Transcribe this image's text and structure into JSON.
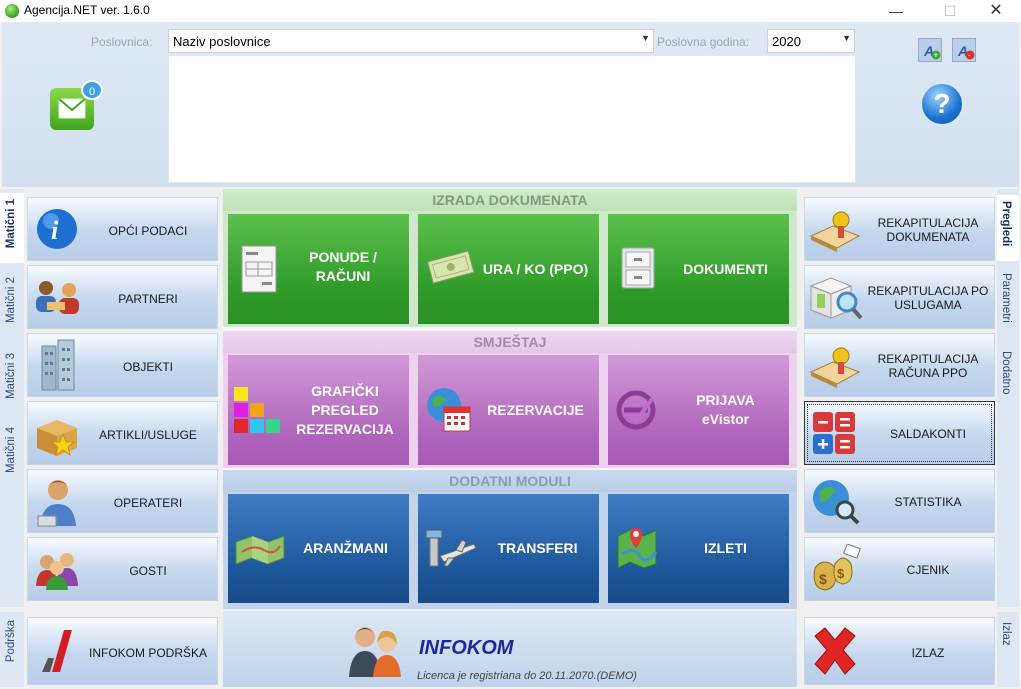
{
  "window": {
    "title": "Agencija.NET ver. 1.6.0"
  },
  "header": {
    "branch_label": "Poslovnica:",
    "branch_value": "Naziv poslovnice",
    "year_label": "Poslovna godina:",
    "year_value": "2020",
    "mail_count": "0"
  },
  "left_tabs": [
    "Matični 1",
    "Matični 2",
    "Matični 3",
    "Matični 4"
  ],
  "left_bottom_tab": "Podrška",
  "right_tabs": [
    "Pregledi",
    "Parametri",
    "Dodatno"
  ],
  "right_bottom_tab": "Izlaz",
  "left_buttons": [
    "OPĆI PODACI",
    "PARTNERI",
    "OBJEKTI",
    "ARTIKLI/USLUGE",
    "OPERATERI",
    "GOSTI"
  ],
  "support_button": "INFOKOM PODRŠKA",
  "sections": {
    "docs": {
      "title": "IZRADA DOKUMENATA",
      "tiles": [
        "PONUDE /\nRAČUNI",
        "URA / KO (PPO)",
        "DOKUMENTI"
      ]
    },
    "stay": {
      "title": "SMJEŠTAJ",
      "tiles": [
        "GRAFIČKI\nPREGLED\nREZERVACIJA",
        "REZERVACIJE",
        "PRIJAVA\neVistor"
      ]
    },
    "extra": {
      "title": "DODATNI MODULI",
      "tiles": [
        "ARANŽMANI",
        "TRANSFERI",
        "IZLETI"
      ]
    }
  },
  "right_buttons": [
    "REKAPITULACIJA\nDOKUMENATA",
    "REKAPITULACIJA PO\nUSLUGAMA",
    "REKAPITULACIJA\nRAČUNA PPO",
    "SALDAKONTI",
    "STATISTIKA",
    "CJENIK"
  ],
  "exit_button": "IZLAZ",
  "footer": {
    "company": "INFOKOM",
    "license": "Licenca je registriana do 20.11.2070.(DEMO)"
  },
  "colors": {
    "green_tile": "#2f9a28",
    "purple_tile": "#b066bc",
    "blue_tile": "#1d579b"
  }
}
